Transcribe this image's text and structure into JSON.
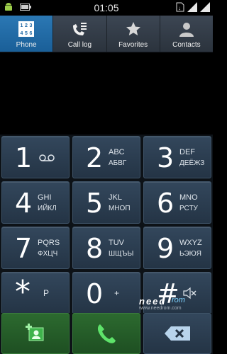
{
  "status_bar": {
    "time": "01:05",
    "left_icons": [
      "android-icon",
      "battery-icon"
    ],
    "right_icons": [
      "sim-icon",
      "signal-icon-1",
      "signal-icon-2"
    ]
  },
  "tabs": [
    {
      "label": "Phone",
      "icon": "dialpad-icon",
      "active": true
    },
    {
      "label": "Call log",
      "icon": "call-log-icon",
      "active": false
    },
    {
      "label": "Favorites",
      "icon": "star-icon",
      "active": false
    },
    {
      "label": "Contacts",
      "icon": "person-icon",
      "active": false
    }
  ],
  "keypad": [
    {
      "digit": "1",
      "sub1": "",
      "sub2": "",
      "icon": "voicemail-icon"
    },
    {
      "digit": "2",
      "sub1": "ABC",
      "sub2": "АБВГ"
    },
    {
      "digit": "3",
      "sub1": "DEF",
      "sub2": "ДЕЁЖЗ"
    },
    {
      "digit": "4",
      "sub1": "GHI",
      "sub2": "ИЙКЛ"
    },
    {
      "digit": "5",
      "sub1": "JKL",
      "sub2": "МНОП"
    },
    {
      "digit": "6",
      "sub1": "MNO",
      "sub2": "РСТУ"
    },
    {
      "digit": "7",
      "sub1": "PQRS",
      "sub2": "ФХЦЧ"
    },
    {
      "digit": "8",
      "sub1": "TUV",
      "sub2": "ШЩЪЫ"
    },
    {
      "digit": "9",
      "sub1": "WXYZ",
      "sub2": "ЬЭЮЯ"
    },
    {
      "digit": "*",
      "center": "P"
    },
    {
      "digit": "0",
      "center": "+"
    },
    {
      "digit": "#",
      "icon": "mute-icon"
    }
  ],
  "actions": [
    {
      "name": "add-contact-button",
      "icon": "add-contact-icon"
    },
    {
      "name": "call-button",
      "icon": "phone-icon"
    },
    {
      "name": "backspace-button",
      "icon": "backspace-icon"
    }
  ],
  "watermark": {
    "main": "need",
    "sub": "rom",
    "url": "www.needrom.com"
  },
  "colors": {
    "active_tab": "#1f6aa6",
    "key_bg": "#2c3e52",
    "call_green": "#2c6a2f"
  }
}
